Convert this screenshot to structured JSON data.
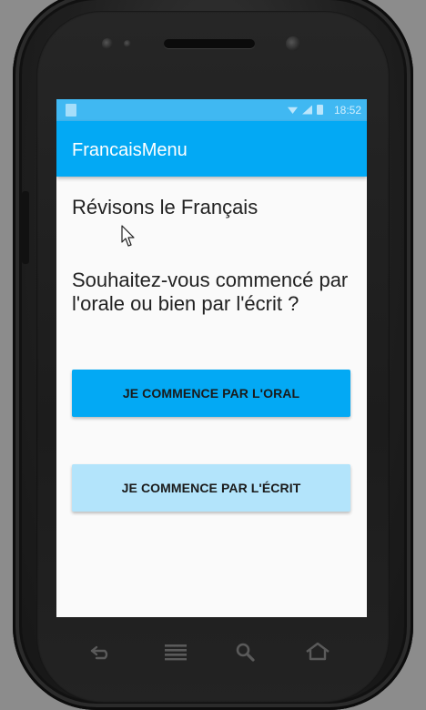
{
  "status_bar": {
    "time": "18:52"
  },
  "app_bar": {
    "title": "FrancaisMenu"
  },
  "content": {
    "heading": "Révisons le Français",
    "question": "Souhaitez-vous commencé par l'orale ou bien par l'écrit ?"
  },
  "buttons": {
    "oral_label": "JE COMMENCE PAR L'ORAL",
    "ecrit_label": "JE COMMENCE PAR L'ÉCRIT"
  },
  "colors": {
    "primary": "#03a9f4",
    "status_bar": "#40b8f2",
    "button_light": "#b3e4fb",
    "background": "#fafafa"
  },
  "hardware_keys": [
    "back-icon",
    "menu-icon",
    "search-icon",
    "home-icon"
  ]
}
